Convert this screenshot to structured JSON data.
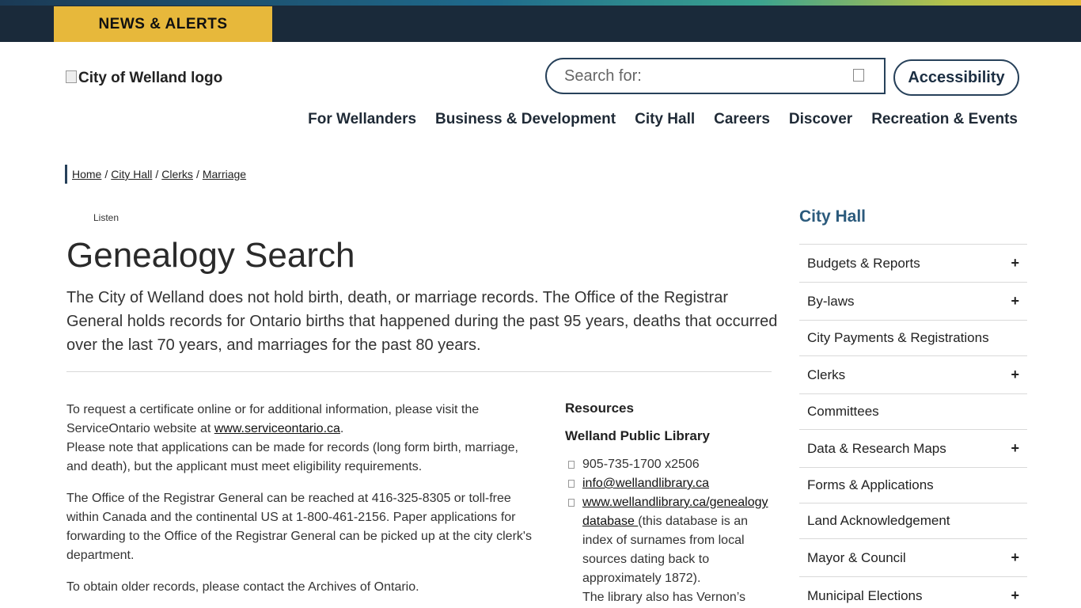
{
  "header": {
    "news_alerts": "NEWS & ALERTS",
    "logo_alt": "City of Welland logo",
    "search_placeholder": "Search for:",
    "accessibility": "Accessibility"
  },
  "nav": {
    "items": [
      "For Wellanders",
      "Business & Development",
      "City Hall",
      "Careers",
      "Discover",
      "Recreation & Events"
    ]
  },
  "breadcrumb": {
    "items": [
      "Home",
      "City Hall",
      "Clerks",
      "Marriage"
    ],
    "separator": "/"
  },
  "listen_label": "Listen",
  "page": {
    "title": "Genealogy Search",
    "intro": "The City of Welland does not hold birth, death, or marriage records. The Office of the Registrar General holds records for Ontario births that happened during the past 95 years, deaths that occurred over the last 70 years, and marriages for the past 80 years.",
    "p1_pre": "To request a certificate online or for additional information, please visit the ServiceOntario website at ",
    "p1_link": "www.serviceontario.ca",
    "p1_post": ".",
    "p1_note": "Please note that applications can be made for records (long form birth, marriage, and death), but the applicant must meet eligibility requirements.",
    "p2": "The Office of the Registrar General can be reached at 416-325-8305 or toll-free within Canada and the continental US at 1-800-461-2156. Paper applications for forwarding to the Office of the Registrar General can be picked up at the city clerk's department.",
    "p3": "To obtain older records, please contact the Archives of Ontario."
  },
  "resources": {
    "heading": "Resources",
    "subheading": "Welland Public Library",
    "phone": "905-735-1700 x2506",
    "email": "info@wellandlibrary.ca",
    "db_link": "www.wellandlibrary.ca/genealogy database ",
    "db_text": "(this database is an index of surnames from local sources dating back to approximately 1872).",
    "more": "The library also has Vernon’s"
  },
  "sidebar": {
    "title": "City Hall",
    "plus_symbol": "+",
    "items": [
      {
        "label": "Budgets & Reports",
        "expandable": true
      },
      {
        "label": "By-laws",
        "expandable": true
      },
      {
        "label": "City Payments & Registrations",
        "expandable": false
      },
      {
        "label": "Clerks",
        "expandable": true
      },
      {
        "label": "Committees",
        "expandable": false
      },
      {
        "label": "Data & Research Maps",
        "expandable": true
      },
      {
        "label": "Forms & Applications",
        "expandable": false
      },
      {
        "label": "Land Acknowledgement",
        "expandable": false
      },
      {
        "label": "Mayor & Council",
        "expandable": true
      },
      {
        "label": "Municipal Elections",
        "expandable": true
      }
    ]
  }
}
